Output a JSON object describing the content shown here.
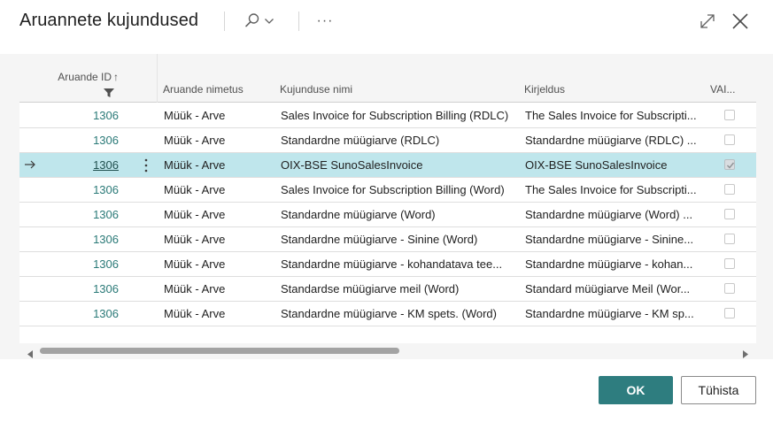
{
  "dialog": {
    "title": "Aruannete kujundused"
  },
  "toolbar": {
    "search_icon": "search-icon",
    "more_label": "···",
    "expand_icon": "expand-icon",
    "close_icon": "close-icon"
  },
  "columns": {
    "report_id": "Aruande ID",
    "report_id_sort": "↑",
    "report_name": "Aruande nimetus",
    "layout_name": "Kujunduse nimi",
    "description": "Kirjeldus",
    "selected": "VAI..."
  },
  "rows": [
    {
      "id": "1306",
      "report_name": "Müük - Arve",
      "layout_name": "Sales Invoice for Subscription Billing (RDLC)",
      "description": "The Sales Invoice for Subscripti...",
      "checked": false
    },
    {
      "id": "1306",
      "report_name": "Müük - Arve",
      "layout_name": "Standardne müügiarve (RDLC)",
      "description": "Standardne müügiarve (RDLC) ...",
      "checked": false
    },
    {
      "id": "1306",
      "report_name": "Müük - Arve",
      "layout_name": "OIX-BSE SunoSalesInvoice",
      "description": "OIX-BSE SunoSalesInvoice",
      "checked": true
    },
    {
      "id": "1306",
      "report_name": "Müük - Arve",
      "layout_name": "Sales Invoice for Subscription Billing (Word)",
      "description": "The Sales Invoice for Subscripti...",
      "checked": false
    },
    {
      "id": "1306",
      "report_name": "Müük - Arve",
      "layout_name": "Standardne müügiarve (Word)",
      "description": "Standardne müügiarve (Word) ...",
      "checked": false
    },
    {
      "id": "1306",
      "report_name": "Müük - Arve",
      "layout_name": "Standardne müügiarve - Sinine (Word)",
      "description": "Standardne müügiarve - Sinine...",
      "checked": false
    },
    {
      "id": "1306",
      "report_name": "Müük - Arve",
      "layout_name": "Standardne müügiarve - kohandatava tee...",
      "description": "Standardne müügiarve - kohan...",
      "checked": false
    },
    {
      "id": "1306",
      "report_name": "Müük - Arve",
      "layout_name": "Standardse müügiarve meil (Word)",
      "description": "Standard müügiarve Meil (Wor...",
      "checked": false
    },
    {
      "id": "1306",
      "report_name": "Müük - Arve",
      "layout_name": "Standardne müügiarve - KM spets. (Word)",
      "description": "Standardne müügiarve - KM sp...",
      "checked": false
    }
  ],
  "selected_row_index": 2,
  "scrollbar": {
    "horizontal_position": 0
  },
  "buttons": {
    "ok": "OK",
    "cancel": "Tühista"
  },
  "colors": {
    "accent": "#2e7d7f",
    "selected_row": "#bfe6ec",
    "id_link": "#2b7a78"
  }
}
